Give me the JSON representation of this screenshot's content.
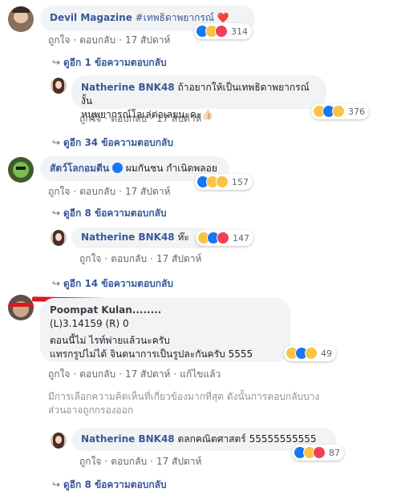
{
  "labels": {
    "like": "ถูกใจ",
    "reply": "ตอบกลับ",
    "edit": "แก้ไขแล้ว",
    "separator": "·"
  },
  "comments": [
    {
      "name": "Devil Magazine",
      "text": "#เทพธิดาพยากรณ์ ",
      "emoji_text": "❤️",
      "time": "17 สัปดาห์",
      "reactions_count": "314",
      "replies": "ดูอีก 1 ข้อความตอบกลับ"
    },
    {
      "name": "Natherine BNK48",
      "text_line1": "ถ้าอยากให้เป็นเทพธิดาพยากรณ์ งั้น",
      "text_line2": "หนูพยากรณ์โอเล่ต่อเลยนะคะ👍🏻",
      "time": "17 สัปดาห์",
      "reactions_count": "376",
      "replies": "ดูอีก 34 ข้อความตอบกลับ"
    },
    {
      "name": "สัตว์โลกอมตีน",
      "text": "ผมกันชน กำเนิดพลอย",
      "time": "17 สัปดาห์",
      "reactions_count": "157",
      "replies": "ดูอีก 8 ข้อความตอบกลับ"
    },
    {
      "name": "Natherine BNK48",
      "text": "ห๊ะ",
      "time": "17 สัปดาห์",
      "reactions_count": "147",
      "replies": "ดูอีก 14 ข้อความตอบกลับ"
    },
    {
      "name_obscured": "Poompat Kulan........",
      "text_line1": "(L)3.14159 (R) 0",
      "text_line2": "ตอนนี้ไม่ ไรท์พ่ายแล้วนะครับ",
      "text_line3": "แทรกรูปไม่ได้ จินตนาการเป็นรูปละกันครับ 5555",
      "time": "17 สัปดาห์",
      "reactions_count": "49"
    },
    {
      "name": "Natherine BNK48",
      "text": "ตลกคณิตศาสตร์ 55555555555",
      "time": "17 สัปดาห์",
      "reactions_count": "87",
      "replies": "ดูอีก 8 ข้อความตอบกลับ"
    }
  ],
  "notice": {
    "line1": "มีการเลือกความคิดเห็นที่เกี่ยวข้องมากที่สุด ดังนั้นการตอบกลับบาง",
    "line2": "ส่วนอาจถูกกรองออก"
  }
}
